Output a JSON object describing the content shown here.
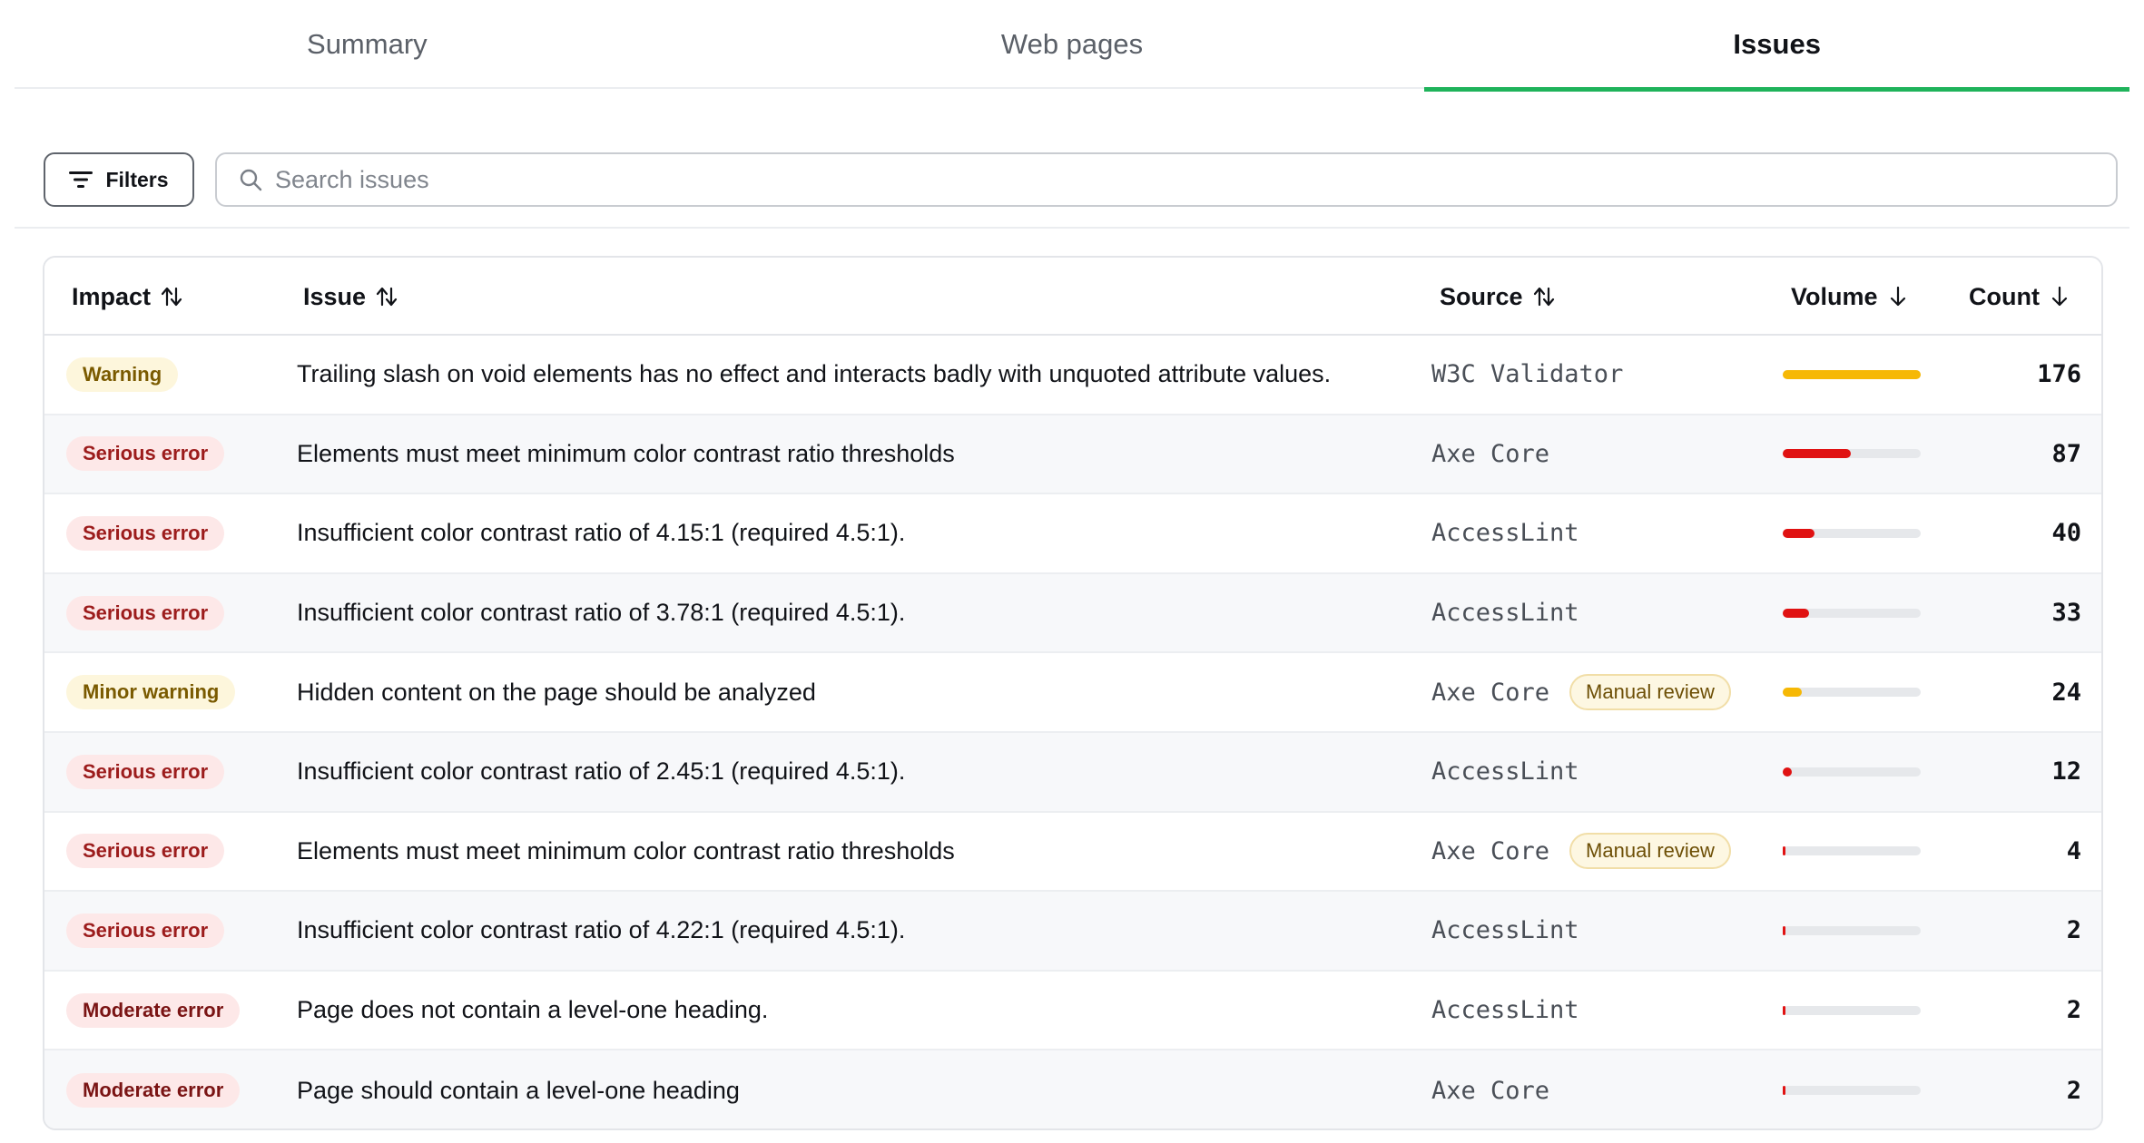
{
  "tabs": [
    {
      "label": "Summary",
      "active": false
    },
    {
      "label": "Web pages",
      "active": false
    },
    {
      "label": "Issues",
      "active": true
    }
  ],
  "toolbar": {
    "filters_label": "Filters",
    "search_placeholder": "Search issues",
    "search_value": ""
  },
  "table": {
    "headers": {
      "impact": "Impact",
      "issue": "Issue",
      "source": "Source",
      "volume": "Volume",
      "count": "Count"
    },
    "rows": [
      {
        "impact": "Warning",
        "impact_color": "#7a5a00",
        "impact_bg": "#fdf6dc",
        "issue": "Trailing slash on void elements has no effect and interacts badly with unquoted attribute values.",
        "source": "W3C Validator",
        "manual_review": "",
        "volume_fraction": 1.0,
        "volume_color": "#f6b805",
        "count": "176"
      },
      {
        "impact": "Serious error",
        "impact_color": "#9c1c1c",
        "impact_bg": "#fde8e8",
        "issue": "Elements must meet minimum color contrast ratio thresholds",
        "source": "Axe Core",
        "manual_review": "",
        "volume_fraction": 0.494,
        "volume_color": "#e01212",
        "count": "87"
      },
      {
        "impact": "Serious error",
        "impact_color": "#9c1c1c",
        "impact_bg": "#fde8e8",
        "issue": "Insufficient color contrast ratio of 4.15:1 (required 4.5:1).",
        "source": "AccessLint",
        "manual_review": "",
        "volume_fraction": 0.227,
        "volume_color": "#e01212",
        "count": "40"
      },
      {
        "impact": "Serious error",
        "impact_color": "#9c1c1c",
        "impact_bg": "#fde8e8",
        "issue": "Insufficient color contrast ratio of 3.78:1 (required 4.5:1).",
        "source": "AccessLint",
        "manual_review": "",
        "volume_fraction": 0.1875,
        "volume_color": "#e01212",
        "count": "33"
      },
      {
        "impact": "Minor warning",
        "impact_color": "#7a5a00",
        "impact_bg": "#fdf6dc",
        "issue": "Hidden content on the page should be analyzed",
        "source": "Axe Core",
        "manual_review": "Manual review",
        "volume_fraction": 0.136,
        "volume_color": "#f6b805",
        "count": "24"
      },
      {
        "impact": "Serious error",
        "impact_color": "#9c1c1c",
        "impact_bg": "#fde8e8",
        "issue": "Insufficient color contrast ratio of 2.45:1 (required 4.5:1).",
        "source": "AccessLint",
        "manual_review": "",
        "volume_fraction": 0.068,
        "volume_color": "#e01212",
        "count": "12"
      },
      {
        "impact": "Serious error",
        "impact_color": "#9c1c1c",
        "impact_bg": "#fde8e8",
        "issue": "Elements must meet minimum color contrast ratio thresholds",
        "source": "Axe Core",
        "manual_review": "Manual review",
        "volume_fraction": 0.023,
        "volume_color": "#e01212",
        "count": "4"
      },
      {
        "impact": "Serious error",
        "impact_color": "#9c1c1c",
        "impact_bg": "#fde8e8",
        "issue": "Insufficient color contrast ratio of 4.22:1 (required 4.5:1).",
        "source": "AccessLint",
        "manual_review": "",
        "volume_fraction": 0.011,
        "volume_color": "#e01212",
        "count": "2"
      },
      {
        "impact": "Moderate error",
        "impact_color": "#7a1414",
        "impact_bg": "#fde8e8",
        "issue": "Page does not contain a level-one heading.",
        "source": "AccessLint",
        "manual_review": "",
        "volume_fraction": 0.011,
        "volume_color": "#e01212",
        "count": "2"
      },
      {
        "impact": "Moderate error",
        "impact_color": "#7a1414",
        "impact_bg": "#fde8e8",
        "issue": "Page should contain a level-one heading",
        "source": "Axe Core",
        "manual_review": "",
        "volume_fraction": 0.011,
        "volume_color": "#e01212",
        "count": "2"
      }
    ]
  },
  "colors": {
    "active_tab_underline": "#1fb35b",
    "warning_bar": "#f6b805",
    "error_bar": "#e01212"
  },
  "icons": {
    "filters": "filter-lines-icon",
    "search": "search-icon",
    "sort_both": "sort-arrows-icon",
    "sort_down": "arrow-down-icon"
  }
}
